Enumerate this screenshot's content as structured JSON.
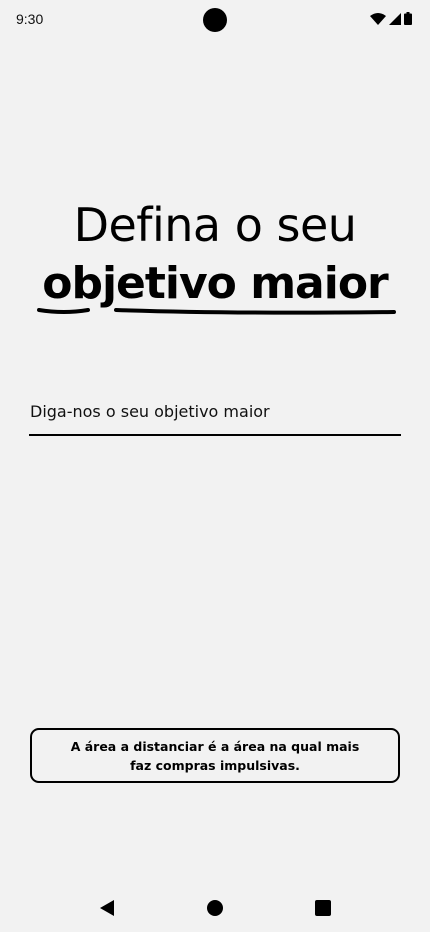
{
  "status_bar": {
    "time": "9:30",
    "icons": [
      "wifi-icon",
      "signal-icon",
      "battery-icon"
    ]
  },
  "title": {
    "line1": "Defina o seu",
    "line2": "objetivo maior"
  },
  "goal_input": {
    "placeholder": "Diga-nos o seu objetivo maior",
    "value": ""
  },
  "info_box": {
    "text": "A área a distanciar é a área na qual mais faz compras impulsivas."
  },
  "nav_bar": {
    "buttons": [
      "back-icon",
      "home-icon",
      "recents-icon"
    ]
  },
  "colors": {
    "background": "#f2f2f2",
    "foreground": "#000000"
  }
}
